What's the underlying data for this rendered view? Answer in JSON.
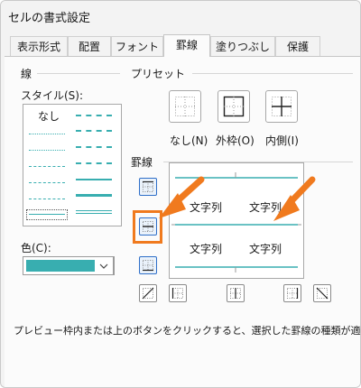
{
  "window": {
    "title": "セルの書式設定"
  },
  "tabs": [
    {
      "label": "表示形式",
      "active": false
    },
    {
      "label": "配置",
      "active": false
    },
    {
      "label": "フォント",
      "active": false
    },
    {
      "label": "罫線",
      "active": true
    },
    {
      "label": "塗りつぶし",
      "active": false
    },
    {
      "label": "保護",
      "active": false
    }
  ],
  "line_group": {
    "title": "線",
    "style_label": "スタイル(S):",
    "none_label": "なし",
    "color_label": "色(C):",
    "color_value": "#38aeb0"
  },
  "preset_group": {
    "title": "プリセット",
    "presets": [
      {
        "label": "なし(N)",
        "icon": "preset-none-icon"
      },
      {
        "label": "外枠(O)",
        "icon": "preset-outline-icon"
      },
      {
        "label": "内側(I)",
        "icon": "preset-inside-icon"
      }
    ]
  },
  "border_group": {
    "title": "罫線",
    "preview_cells": [
      "文字列",
      "文字列",
      "文字列",
      "文字列"
    ],
    "line_color": "#38aeb0"
  },
  "hint_text": "プレビュー枠内または上のボタンをクリックすると、選択した罫線の種類が適用されます。",
  "annotation": {
    "color": "#f07a1e"
  }
}
